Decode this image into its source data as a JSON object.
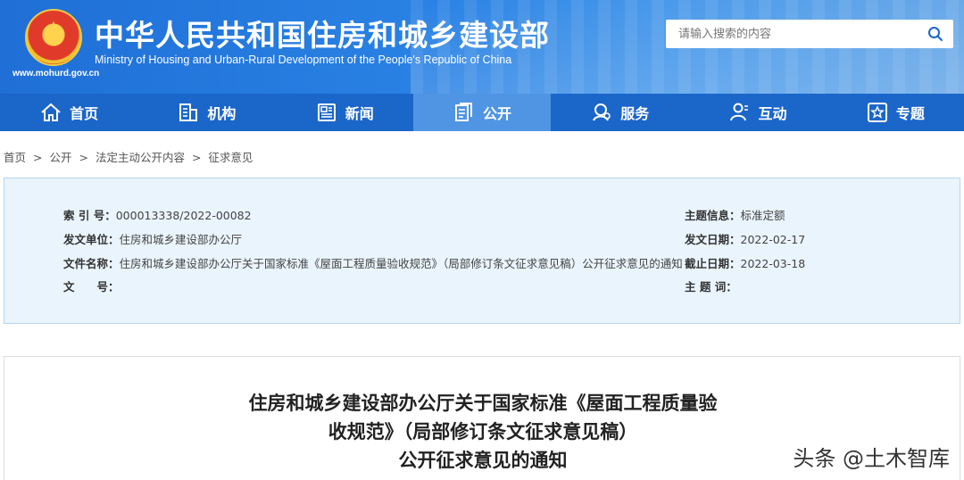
{
  "header": {
    "title": "中华人民共和国住房和城乡建设部",
    "subtitle": "Ministry of Housing and Urban-Rural Development of the People's Republic of China",
    "url": "www.mohurd.gov.cn",
    "emblem_icon": "national-emblem-icon"
  },
  "search": {
    "placeholder": "请输入搜索的内容",
    "icon": "search-icon"
  },
  "nav": {
    "items": [
      {
        "label": "首页",
        "icon": "home-icon"
      },
      {
        "label": "机构",
        "icon": "building-icon"
      },
      {
        "label": "新闻",
        "icon": "news-icon"
      },
      {
        "label": "公开",
        "icon": "document-icon",
        "active": true
      },
      {
        "label": "服务",
        "icon": "service-icon"
      },
      {
        "label": "互动",
        "icon": "user-interaction-icon"
      },
      {
        "label": "专题",
        "icon": "star-icon"
      }
    ]
  },
  "breadcrumb": {
    "items": [
      "首页",
      "公开",
      "法定主动公开内容",
      "征求意见"
    ],
    "separator": ">"
  },
  "info": {
    "index_label": "索 引 号：",
    "index_value": "000013338/2022-00082",
    "issuer_label": "发文单位：",
    "issuer_value": "住房和城乡建设部办公厅",
    "docname_label": "文件名称：",
    "docname_value": "住房和城乡建设部办公厅关于国家标准《屋面工程质量验收规范》（局部修订条文征求意见稿）公开征求意见的通知",
    "docno_label": "文　　号：",
    "docno_value": "",
    "topic_label": "主题信息：",
    "topic_value": "标准定额",
    "date_label": "发文日期：",
    "date_value": "2022-02-17",
    "deadline_label": "截止日期：",
    "deadline_value": "2022-03-18",
    "keyword_label": "主 题 词：",
    "keyword_value": ""
  },
  "article": {
    "title_line1": "住房和城乡建设部办公厅关于国家标准《屋面工程质量验",
    "title_line2": "收规范》（局部修订条文征求意见稿）",
    "title_line3": "公开征求意见的通知"
  },
  "watermark": "头条 @土木智库",
  "colors": {
    "header_blue": "#2a82e4",
    "nav_blue": "#1b66c9",
    "nav_active": "#4f95e3",
    "info_bg": "#eaf4fd",
    "info_border": "#b7d5f1"
  }
}
